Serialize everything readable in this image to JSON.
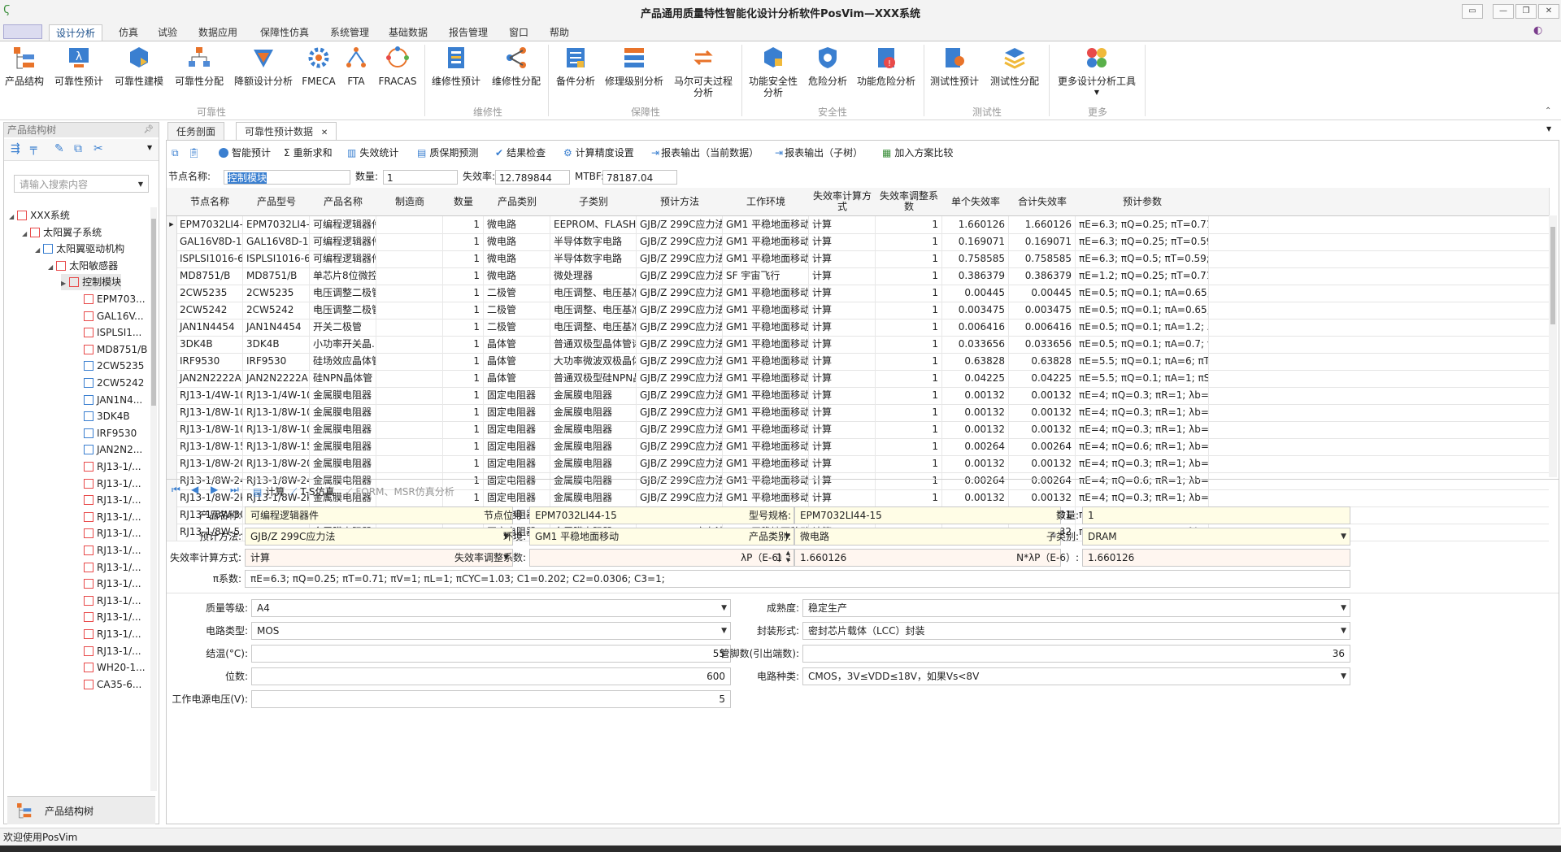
{
  "window": {
    "title": "产品通用质量特性智能化设计分析软件PosVim—XXX系统"
  },
  "menu": {
    "tabs": [
      "设计分析",
      "仿真",
      "试验",
      "数据应用",
      "保障性仿真",
      "系统管理",
      "基础数据",
      "报告管理",
      "窗口",
      "帮助"
    ],
    "active": "设计分析"
  },
  "ribbon": {
    "buttons": [
      "产品结构",
      "可靠性预计",
      "可靠性建模",
      "可靠性分配",
      "降额设计分析",
      "FMECA",
      "FTA",
      "FRACAS",
      "维修性预计",
      "维修性分配",
      "备件分析",
      "修理级别分析",
      "马尔可夫过程分析",
      "功能安全性分析",
      "危险分析",
      "功能危险分析",
      "测试性预计",
      "测试性分配",
      "更多设计分析工具"
    ],
    "groups": [
      "可靠性",
      "维修性",
      "保障性",
      "安全性",
      "测试性",
      "更多"
    ]
  },
  "left_panel": {
    "title": "产品结构树",
    "search_placeholder": "请输入搜索内容",
    "tree": [
      "XXX系统",
      "太阳翼子系统",
      "太阳翼驱动机构",
      "太阳敏感器",
      "控制模块",
      "EPM703...",
      "GAL16V...",
      "ISPLSI1...",
      "MD8751/B",
      "2CW5235",
      "2CW5242",
      "JAN1N4...",
      "3DK4B",
      "IRF9530",
      "JAN2N2...",
      "RJ13-1/...",
      "RJ13-1/...",
      "RJ13-1/...",
      "RJ13-1/...",
      "RJ13-1/...",
      "RJ13-1/...",
      "RJ13-1/...",
      "RJ13-1/...",
      "RJ13-1/...",
      "RJ13-1/...",
      "RJ13-1/...",
      "RJ13-1/...",
      "WH20-1...",
      "CA35-6..."
    ],
    "footer_label": "产品结构树"
  },
  "doc_tabs": [
    "任务剖面",
    "可靠性预计数据"
  ],
  "toolbar": {
    "buttons": [
      "智能预计",
      "重新求和",
      "失效统计",
      "质保期预测",
      "结果检查",
      "计算精度设置",
      "报表输出（当前数据）",
      "报表输出（子树）",
      "加入方案比较"
    ]
  },
  "summary": {
    "node_name_label": "节点名称:",
    "node_name": "控制模块",
    "qty_label": "数量:",
    "qty": "1",
    "failrate_label": "失效率:",
    "failrate": "12.789844",
    "mtbf_label": "MTBF:",
    "mtbf": "78187.04"
  },
  "grid": {
    "headers": [
      "节点名称",
      "产品型号",
      "产品名称",
      "制造商",
      "数量",
      "产品类别",
      "子类别",
      "预计方法",
      "工作环境",
      "失效率计算方式",
      "失效率调整系数",
      "单个失效率",
      "合计失效率",
      "预计参数"
    ],
    "rows": [
      [
        "EPM7032LI4-...",
        "EPM7032LI4-...",
        "可编程逻辑器件",
        "",
        "1",
        "微电路",
        "EEPROM、FLASH",
        "GJB/Z 299C应力法",
        "GM1 平稳地面移动",
        "计算",
        "1",
        "1.660126",
        "1.660126",
        "πE=6.3; πQ=0.25; πT=0.71; ..."
      ],
      [
        "GAL16V8D-15...",
        "GAL16V8D-15...",
        "可编程逻辑器件",
        "",
        "1",
        "微电路",
        "半导体数字电路",
        "GJB/Z 299C应力法",
        "GM1 平稳地面移动",
        "计算",
        "1",
        "0.169071",
        "0.169071",
        "πE=6.3; πQ=0.25; πT=0.59; ..."
      ],
      [
        "ISPLSI1016-6...",
        "ISPLSI1016-6...",
        "可编程逻辑器件",
        "",
        "1",
        "微电路",
        "半导体数字电路",
        "GJB/Z 299C应力法",
        "GM1 平稳地面移动",
        "计算",
        "1",
        "0.758585",
        "0.758585",
        "πE=6.3; πQ=0.5; πT=0.59; π..."
      ],
      [
        "MD8751/B",
        "MD8751/B",
        "单芯片8位微控...",
        "",
        "1",
        "微电路",
        "微处理器",
        "GJB/Z 299C应力法",
        "SF 宇宙飞行",
        "计算",
        "1",
        "0.386379",
        "0.386379",
        "πE=1.2; πQ=0.25; πT=0.71; ..."
      ],
      [
        "2CW5235",
        "2CW5235",
        "电压调整二极管",
        "",
        "1",
        "二极管",
        "电压调整、电压基准...",
        "GJB/Z 299C应力法",
        "GM1 平稳地面移动",
        "计算",
        "1",
        "0.00445",
        "0.00445",
        "πE=0.5; πQ=0.1; πA=0.65; λ..."
      ],
      [
        "2CW5242",
        "2CW5242",
        "电压调整二极管",
        "",
        "1",
        "二极管",
        "电压调整、电压基准...",
        "GJB/Z 299C应力法",
        "GM1 平稳地面移动",
        "计算",
        "1",
        "0.003475",
        "0.003475",
        "πE=0.5; πQ=0.1; πA=0.65; λ..."
      ],
      [
        "JAN1N4454",
        "JAN1N4454",
        "开关二极管",
        "",
        "1",
        "二极管",
        "电压调整、电压基准...",
        "GJB/Z 299C应力法",
        "GM1 平稳地面移动",
        "计算",
        "1",
        "0.006416",
        "0.006416",
        "πE=0.5; πQ=0.1; πA=1.2; λb..."
      ],
      [
        "3DK4B",
        "3DK4B",
        "小功率开关晶...",
        "",
        "1",
        "晶体管",
        "普通双极型晶体管诸...",
        "GJB/Z 299C应力法",
        "GM1 平稳地面移动",
        "计算",
        "1",
        "0.033656",
        "0.033656",
        "πE=0.5; πQ=0.1; πA=0.7; πS..."
      ],
      [
        "IRF9530",
        "IRF9530",
        "硅场效应晶体管",
        "",
        "1",
        "晶体管",
        "大功率微波双极晶体管",
        "GJB/Z 299C应力法",
        "GM1 平稳地面移动",
        "计算",
        "1",
        "0.63828",
        "0.63828",
        "πE=5.5; πQ=0.1; πA=6; πT=..."
      ],
      [
        "JAN2N2222A",
        "JAN2N2222A",
        "硅NPN晶体管 ...",
        "",
        "1",
        "晶体管",
        "普通双极型硅NPN晶...",
        "GJB/Z 299C应力法",
        "GM1 平稳地面移动",
        "计算",
        "1",
        "0.04225",
        "0.04225",
        "πE=5.5; πQ=0.1; πA=1; πS2=..."
      ],
      [
        "RJ13-1/4W-10...",
        "RJ13-1/4W-10...",
        "金属膜电阻器",
        "",
        "1",
        "固定电阻器",
        "金属膜电阻器",
        "GJB/Z 299C应力法",
        "GM1 平稳地面移动",
        "计算",
        "1",
        "0.00132",
        "0.00132",
        "πE=4; πQ=0.3; πR=1; λb=0.0..."
      ],
      [
        "RJ13-1/8W-10...",
        "RJ13-1/8W-10...",
        "金属膜电阻器",
        "",
        "1",
        "固定电阻器",
        "金属膜电阻器",
        "GJB/Z 299C应力法",
        "GM1 平稳地面移动",
        "计算",
        "1",
        "0.00132",
        "0.00132",
        "πE=4; πQ=0.3; πR=1; λb=0.0..."
      ],
      [
        "RJ13-1/8W-10...",
        "RJ13-1/8W-10...",
        "金属膜电阻器",
        "",
        "1",
        "固定电阻器",
        "金属膜电阻器",
        "GJB/Z 299C应力法",
        "GM1 平稳地面移动",
        "计算",
        "1",
        "0.00132",
        "0.00132",
        "πE=4; πQ=0.3; πR=1; λb=0.0..."
      ],
      [
        "RJ13-1/8W-15...",
        "RJ13-1/8W-15...",
        "金属膜电阻器",
        "",
        "1",
        "固定电阻器",
        "金属膜电阻器",
        "GJB/Z 299C应力法",
        "GM1 平稳地面移动",
        "计算",
        "1",
        "0.00264",
        "0.00264",
        "πE=4; πQ=0.6; πR=1; λb=0.0..."
      ],
      [
        "RJ13-1/8W-20...",
        "RJ13-1/8W-20...",
        "金属膜电阻器",
        "",
        "1",
        "固定电阻器",
        "金属膜电阻器",
        "GJB/Z 299C应力法",
        "GM1 平稳地面移动",
        "计算",
        "1",
        "0.00132",
        "0.00132",
        "πE=4; πQ=0.3; πR=1; λb=0.0..."
      ],
      [
        "RJ13-1/8W-24...",
        "RJ13-1/8W-24...",
        "金属膜电阻器",
        "",
        "1",
        "固定电阻器",
        "金属膜电阻器",
        "GJB/Z 299C应力法",
        "GM1 平稳地面移动",
        "计算",
        "1",
        "0.00264",
        "0.00264",
        "πE=4; πQ=0.6; πR=1; λb=0.0..."
      ],
      [
        "RJ13-1/8W-2kΩ",
        "RJ13-1/8W-2kΩ",
        "金属膜电阻器",
        "",
        "1",
        "固定电阻器",
        "金属膜电阻器",
        "GJB/Z 299C应力法",
        "GM1 平稳地面移动",
        "计算",
        "1",
        "0.00132",
        "0.00132",
        "πE=4; πQ=0.3; πR=1; λb=0.0..."
      ],
      [
        "RJ13-1/8W-30...",
        "RJ13-1/8W-30...",
        "金属膜电阻器",
        "",
        "1",
        "固定电阻器",
        "金属膜电阻器",
        "GJB/Z 299C应力法",
        "GM1 平稳地面移动",
        "计算",
        "1",
        "0.004401",
        "0.004401",
        "πE=4; πQ=1; πR=1; λb=0.0011"
      ],
      [
        "RJ13-1/8W-5....",
        "RJ13-1/8W-5....",
        "金属膜电阻器",
        "",
        "1",
        "固定电阻器",
        "金属膜电阻器",
        "GJB/Z 299C应力法",
        "GM1 平稳地面移动",
        "计算",
        "1",
        "0.00132",
        "0.00132",
        "πE=4; πQ=0.3; πR=1; λb=0.0..."
      ]
    ]
  },
  "nav": {
    "calc": "计算",
    "ts": "T-S仿真",
    "form": "FORM、MSR仿真分析"
  },
  "detail": {
    "product_name_label": "产品名称:",
    "product_name": "可编程逻辑器件",
    "position_label": "节点位号:",
    "position": "EPM7032LI44-15",
    "model_label": "型号规格:",
    "model": "EPM7032LI44-15",
    "qty_label": "数量:",
    "qty": "1",
    "method_label": "预计方法:",
    "method": "GJB/Z 299C应力法",
    "env_label": "环境:",
    "env": "GM1 平稳地面移动",
    "category_label": "产品类别:",
    "category": "微电路",
    "subcategory_label": "子类别:",
    "subcategory": "DRAM",
    "calcmode_label": "失效率计算方式:",
    "calcmode": "计算",
    "adjust_label": "失效率调整系数:",
    "adjust": "1",
    "lp_label": "λP（E-6）:",
    "lp": "1.660126",
    "nlp_label": "N*λP（E-6）:",
    "nlp": "1.660126",
    "pi_label": "π系数:",
    "pi": "πE=6.3; πQ=0.25; πT=0.71; πV=1; πL=1; πCYC=1.03; C1=0.202; C2=0.0306; C3=1;",
    "quality_label": "质量等级:",
    "quality": "A4",
    "maturity_label": "成熟度:",
    "maturity": "稳定生产",
    "circuit_label": "电路类型:",
    "circuit": "MOS",
    "package_label": "封装形式:",
    "package": "密封芯片载体（LCC）封装",
    "tj_label": "结温(°C):",
    "tj": "55",
    "pins_label": "管脚数(引出端数):",
    "pins": "36",
    "bits_label": "位数:",
    "bits": "600",
    "kind_label": "电路种类:",
    "kind": "CMOS，3V≤VDD≤18V，如果Vs<8V",
    "voltage_label": "工作电源电压(V):",
    "voltage": "5"
  },
  "status": {
    "text": "欢迎使用PosVim"
  }
}
